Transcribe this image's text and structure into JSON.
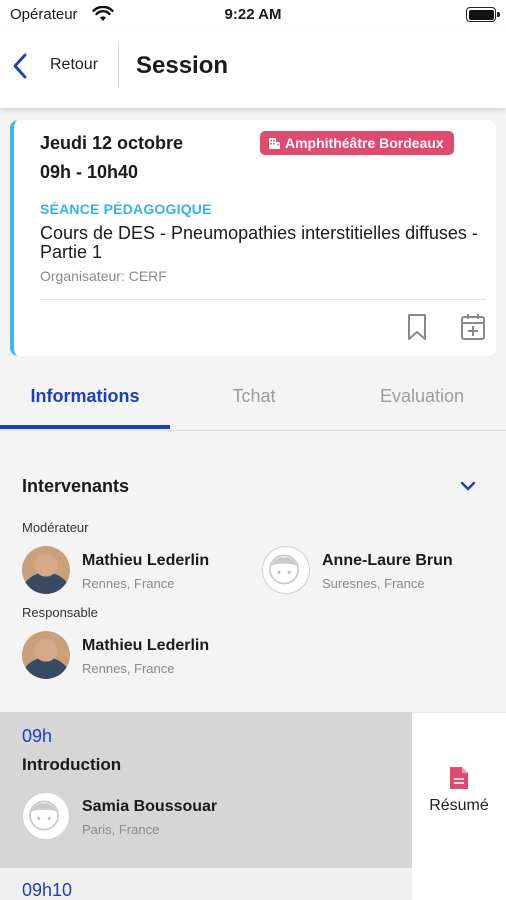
{
  "status_bar": {
    "carrier": "Opérateur",
    "time": "9:22 AM"
  },
  "nav": {
    "back_label": "Retour",
    "title": "Session"
  },
  "session": {
    "date": "Jeudi 12 octobre",
    "time": "09h - 10h40",
    "location": "Amphithéâtre Bordeaux",
    "type": "SÉANCE PÉDAGOGIQUE",
    "title": "Cours de DES - Pneumopathies interstitielles diffuses -  Partie 1",
    "organizer": "Organisateur: CERF",
    "accent_color": "#3fb6e8",
    "badge_color": "#df4b6f"
  },
  "tabs": [
    {
      "label": "Informations",
      "active": true
    },
    {
      "label": "Tchat",
      "active": false
    },
    {
      "label": "Evaluation",
      "active": false
    }
  ],
  "speakers": {
    "title": "Intervenants",
    "moderator_label": "Modérateur",
    "moderators": [
      {
        "name": "Mathieu Lederlin",
        "location": "Rennes, France",
        "avatar": "photo"
      },
      {
        "name": "Anne-Laure Brun",
        "location": "Suresnes, France",
        "avatar": "default"
      }
    ],
    "responsible_label": "Responsable",
    "responsibles": [
      {
        "name": "Mathieu Lederlin",
        "location": "Rennes, France",
        "avatar": "photo"
      }
    ]
  },
  "program": [
    {
      "time": "09h",
      "title": "Introduction",
      "speaker": {
        "name": "Samia Boussouar",
        "location": "Paris, France",
        "avatar": "default"
      },
      "summary_label": "Résumé"
    },
    {
      "time": "09h10"
    }
  ],
  "colors": {
    "primary": "#1b3fb8",
    "summary_icon": "#df4b6f"
  }
}
